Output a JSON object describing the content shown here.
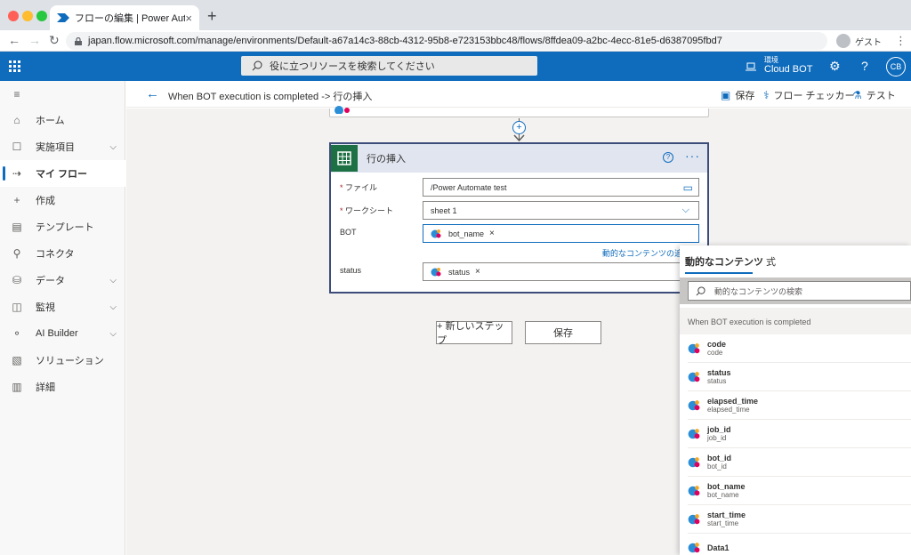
{
  "browser": {
    "tab_title": "フローの編集 | Power Automate",
    "tab_close": "×",
    "new_tab": "+",
    "url": "japan.flow.microsoft.com/manage/environments/Default-a67a14c3-88cb-4312-95b8-e723153bbc48/flows/8ffdea09-a2bc-4ecc-81e5-d6387095fbd7",
    "profile_label": "ゲスト",
    "back": "←",
    "forward": "→",
    "reload": "↻",
    "menu": "⋮"
  },
  "appbar": {
    "search_placeholder": "役に立つリソースを検索してください",
    "env_label": "環境",
    "env_value": "Cloud BOT",
    "settings": "⚙",
    "help": "?",
    "user_initials": "CB"
  },
  "sidebar": {
    "hamburger": "≡",
    "items": [
      {
        "label": "ホーム",
        "icon": "⌂",
        "chevron": ""
      },
      {
        "label": "実施項目",
        "icon": "☐",
        "chevron": "⌵"
      },
      {
        "label": "マイ フロー",
        "icon": "⇢",
        "chevron": ""
      },
      {
        "label": "作成",
        "icon": "+",
        "chevron": ""
      },
      {
        "label": "テンプレート",
        "icon": "▤",
        "chevron": ""
      },
      {
        "label": "コネクタ",
        "icon": "⚲",
        "chevron": ""
      },
      {
        "label": "データ",
        "icon": "⛁",
        "chevron": "⌵"
      },
      {
        "label": "監視",
        "icon": "◫",
        "chevron": "⌵"
      },
      {
        "label": "AI Builder",
        "icon": "⚬",
        "chevron": "⌵"
      },
      {
        "label": "ソリューション",
        "icon": "▧",
        "chevron": ""
      },
      {
        "label": "詳細",
        "icon": "▥",
        "chevron": ""
      }
    ]
  },
  "commandbar": {
    "back": "←",
    "title": "When BOT execution is completed -> 行の挿入",
    "save": "保存",
    "save_icon": "▣",
    "checker": "フロー チェッカー",
    "checker_icon": "⚕",
    "test": "テスト",
    "test_icon": "⚗"
  },
  "canvas": {
    "plus": "+",
    "card": {
      "title": "行の挿入",
      "help": "?",
      "more": "···",
      "fields": [
        {
          "label": "ファイル",
          "required": "*",
          "value": "/Power Automate test",
          "icon": "▭"
        },
        {
          "label": "ワークシート",
          "required": "*",
          "value": "sheet 1",
          "icon": "⌵"
        },
        {
          "label": "BOT",
          "required": "",
          "token": "bot_name"
        },
        {
          "label": "status",
          "required": "",
          "token": "status"
        }
      ],
      "token_remove": "×",
      "dynamic_link": "動的なコンテンツの追"
    },
    "new_step": "+ 新しいステップ",
    "save": "保存"
  },
  "panel": {
    "tab_dynamic": "動的なコンテンツ",
    "tab_expression": "式",
    "search_placeholder": "動的なコンテンツの検索",
    "section": "When BOT execution is completed",
    "items": [
      {
        "name": "code",
        "desc": "code"
      },
      {
        "name": "status",
        "desc": "status"
      },
      {
        "name": "elapsed_time",
        "desc": "elapsed_time"
      },
      {
        "name": "job_id",
        "desc": "job_id"
      },
      {
        "name": "bot_id",
        "desc": "bot_id"
      },
      {
        "name": "bot_name",
        "desc": "bot_name"
      },
      {
        "name": "start_time",
        "desc": "start_time"
      },
      {
        "name": "Data1",
        "desc": ""
      }
    ]
  },
  "colors": {
    "brand": "#0f6cbd",
    "card_border": "#3d4d7a",
    "excel_green": "#1d7044"
  }
}
